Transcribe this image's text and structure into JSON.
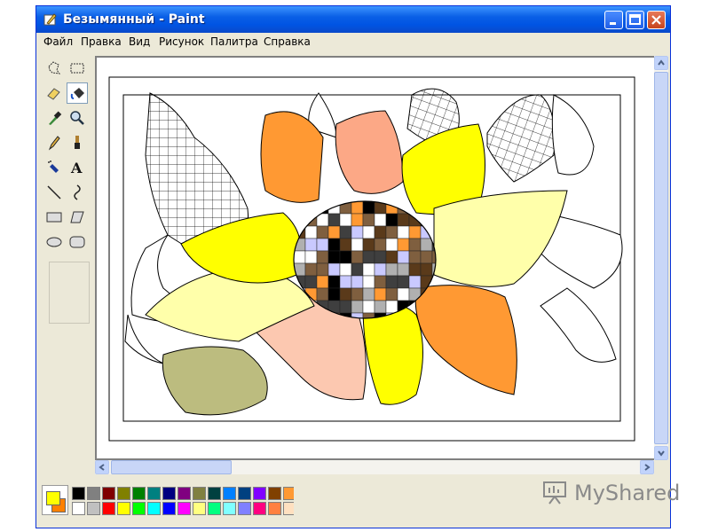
{
  "window": {
    "title": "Безымянный - Paint",
    "controls": [
      "minimize",
      "maximize",
      "close"
    ]
  },
  "menu": [
    "Файл",
    "Правка",
    "Вид",
    "Рисунок",
    "Палитра",
    "Справка"
  ],
  "tools": [
    {
      "name": "free-select-icon",
      "active": false
    },
    {
      "name": "rect-select-icon",
      "active": false
    },
    {
      "name": "eraser-icon",
      "active": false
    },
    {
      "name": "fill-bucket-icon",
      "active": true
    },
    {
      "name": "color-picker-icon",
      "active": false
    },
    {
      "name": "magnifier-icon",
      "active": false
    },
    {
      "name": "pencil-icon",
      "active": false
    },
    {
      "name": "brush-icon",
      "active": false
    },
    {
      "name": "airbrush-icon",
      "active": false
    },
    {
      "name": "text-icon",
      "active": false
    },
    {
      "name": "line-icon",
      "active": false
    },
    {
      "name": "curve-icon",
      "active": false
    },
    {
      "name": "rectangle-icon",
      "active": false
    },
    {
      "name": "polygon-icon",
      "active": false
    },
    {
      "name": "ellipse-icon",
      "active": false
    },
    {
      "name": "rounded-rect-icon",
      "active": false
    }
  ],
  "text_tool_glyph": "A",
  "palette": {
    "foreground": "#ffff00",
    "background": "#ff8000",
    "row1": [
      "#000000",
      "#808080",
      "#800000",
      "#808000",
      "#008000",
      "#008080",
      "#000080",
      "#800080",
      "#808040",
      "#004040",
      "#0080ff",
      "#004080",
      "#8000ff",
      "#804000"
    ],
    "row2": [
      "#ffffff",
      "#c0c0c0",
      "#ff0000",
      "#ffff00",
      "#00ff00",
      "#00ffff",
      "#0000ff",
      "#ff00ff",
      "#ffff80",
      "#00ff80",
      "#80ffff",
      "#8080ff",
      "#ff0080",
      "#ff8040"
    ],
    "row1_extra": "#ff9933",
    "row2_extra": "#ffe0c0"
  },
  "flower_colors": {
    "yellow": "#ffff00",
    "light_yellow": "#ffffaa",
    "orange": "#ff9933",
    "peach": "#fca886",
    "light_peach": "#fcc8b0",
    "olive": "#bcbc7f",
    "center_colors": [
      "#000000",
      "#ffffff",
      "#c9c9ff",
      "#7f5f3f",
      "#ff9933",
      "#3f3f3f",
      "#b0b0b0",
      "#5a3a1a"
    ]
  },
  "watermark": {
    "text": "MyShared"
  }
}
